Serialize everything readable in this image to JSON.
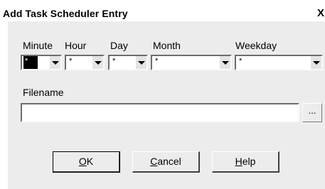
{
  "window": {
    "title": "Add Task Scheduler Entry",
    "close_glyph": "X"
  },
  "schedule": {
    "minute": {
      "label": "Minute",
      "value": "*"
    },
    "hour": {
      "label": "Hour",
      "value": "*"
    },
    "day": {
      "label": "Day",
      "value": "*"
    },
    "month": {
      "label": "Month",
      "value": "*"
    },
    "weekday": {
      "label": "Weekday",
      "value": "*"
    }
  },
  "filename": {
    "label": "Filename",
    "value": "",
    "browse_label": "..."
  },
  "buttons": {
    "ok": {
      "mnemonic": "O",
      "rest": "K"
    },
    "cancel": {
      "mnemonic": "C",
      "rest": "ancel"
    },
    "help": {
      "mnemonic": "H",
      "rest": "elp"
    }
  }
}
